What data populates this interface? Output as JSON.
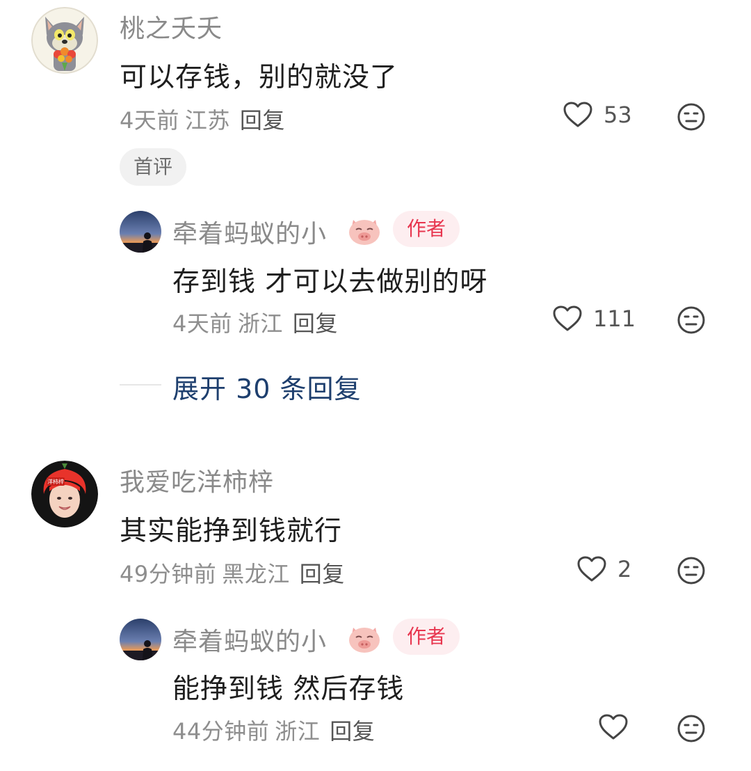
{
  "comments": [
    {
      "username": "桃之夭夭",
      "content": "可以存钱，别的就没了",
      "time": "4天前",
      "location": "江苏",
      "reply_label": "回复",
      "likes": "53",
      "badge": "首评",
      "avatar_icon": "cartoon-cat-avatar",
      "reply": {
        "username": "牵着蚂蚁的小",
        "author_badge": "作者",
        "content": "存到钱 才可以去做别的呀",
        "time": "4天前",
        "location": "浙江",
        "reply_label": "回复",
        "likes": "111",
        "avatar_icon": "sunset-silhouette-avatar"
      },
      "expand_label": "展开 30 条回复"
    },
    {
      "username": "我爱吃洋柿梓",
      "content": "其实能挣到钱就行",
      "time": "49分钟前",
      "location": "黑龙江",
      "reply_label": "回复",
      "likes": "2",
      "avatar_icon": "red-hair-person-avatar",
      "avatar_text": "洋柿梓",
      "reply": {
        "username": "牵着蚂蚁的小",
        "author_badge": "作者",
        "content": "能挣到钱 然后存钱",
        "time": "44分钟前",
        "location": "浙江",
        "reply_label": "回复",
        "likes": "",
        "avatar_icon": "sunset-silhouette-avatar"
      }
    }
  ],
  "colors": {
    "author_badge_text": "#e8364f",
    "author_badge_bg": "#fdeef0",
    "expand_link": "#1e3f6e",
    "meta_text": "#8e8e8e"
  }
}
